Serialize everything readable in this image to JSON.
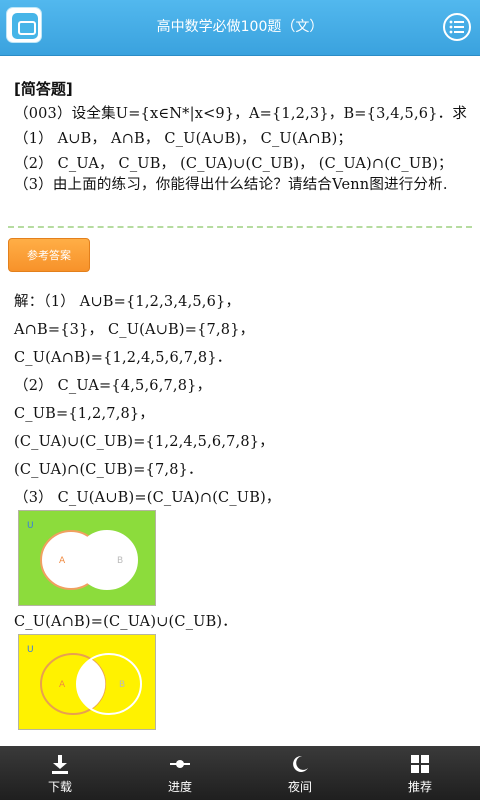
{
  "header": {
    "title": "高中数学必做100题（文）",
    "app_icon": "app-logo-icon",
    "menu_icon": "list-menu-icon"
  },
  "question": {
    "section": "[简答题]",
    "stem": "（003）设全集U={x∈N*|x<9}，A={1,2,3}，B={3,4,5,6}．求",
    "part1": "（1） A∪B， A∩B， C_U(A∪B)， C_U(A∩B)；",
    "part2": "（2） C_UA， C_UB， (C_UA)∪(C_UB)， (C_UA)∩(C_UB)；",
    "part3": "（3）由上面的练习，你能得出什么结论？请结合Venn图进行分析."
  },
  "answer_button": {
    "label": "参考答案"
  },
  "solution": {
    "s1": "解：（1） A∪B={1,2,3,4,5,6}，",
    "s2": "A∩B={3}， C_U(A∪B)={7,8}，",
    "s3": "C_U(A∩B)={1,2,4,5,6,7,8}．",
    "s4": "（2） C_UA={4,5,6,7,8}，",
    "s5": "C_UB={1,2,7,8}，",
    "s6": "(C_UA)∪(C_UB)={1,2,4,5,6,7,8}，",
    "s7": "(C_UA)∩(C_UB)={7,8}．",
    "s8": "（3） C_U(A∪B)=(C_UA)∩(C_UB)，",
    "s9": "C_U(A∩B)=(C_UA)∪(C_UB)．"
  },
  "venn1": {
    "u": "U",
    "a": "A",
    "b": "B",
    "background": "#8cdc3c"
  },
  "venn2": {
    "u": "U",
    "a": "A",
    "b": "B",
    "background": "#fff200"
  },
  "bottom": {
    "tabs": [
      {
        "label": "下载",
        "icon": "download-icon"
      },
      {
        "label": "进度",
        "icon": "progress-slider-icon"
      },
      {
        "label": "夜间",
        "icon": "moon-icon"
      },
      {
        "label": "推荐",
        "icon": "grid-icon"
      }
    ]
  }
}
